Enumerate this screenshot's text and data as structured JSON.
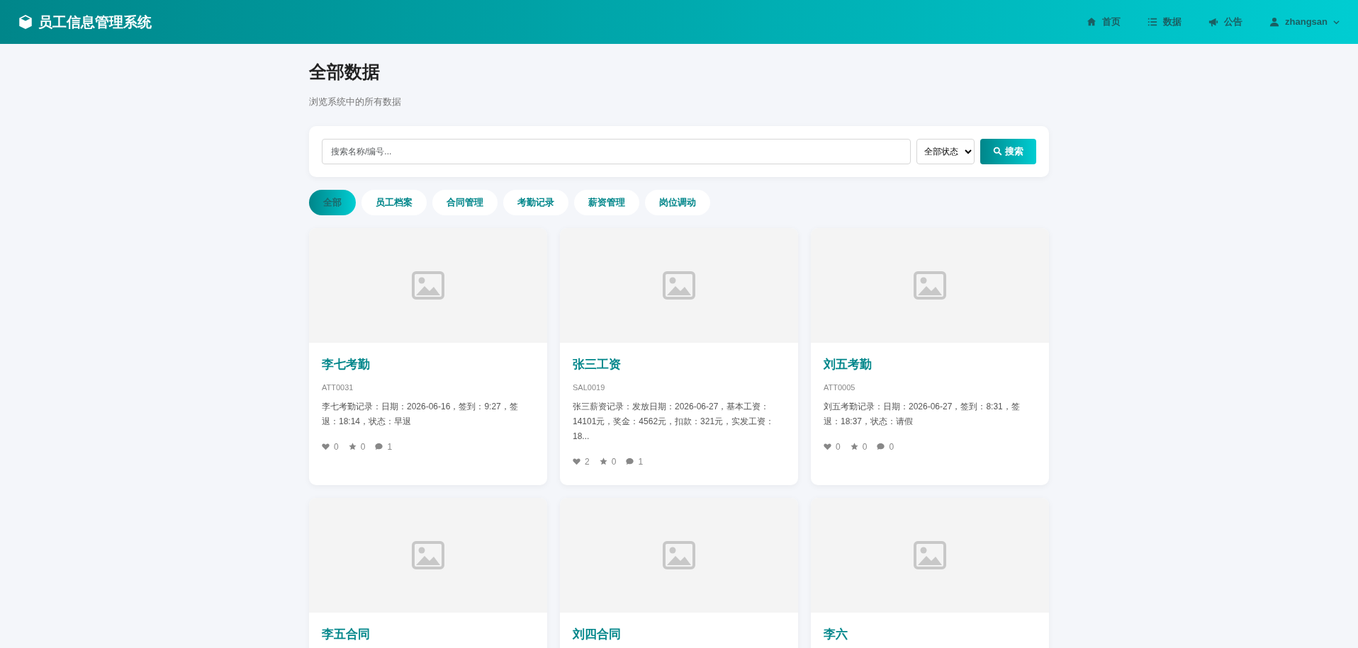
{
  "brand": {
    "title": "员工信息管理系统"
  },
  "nav": [
    {
      "kind": "home",
      "label": "首页"
    },
    {
      "kind": "list",
      "label": "数据"
    },
    {
      "kind": "notice",
      "label": "公告"
    },
    {
      "kind": "user",
      "label": "zhangsan"
    }
  ],
  "page": {
    "title": "全部数据",
    "subtitle": "浏览系统中的所有数据"
  },
  "search": {
    "placeholder": "搜索名称/编号...",
    "status_select": "全部状态",
    "button": "搜索"
  },
  "tabs": [
    {
      "label": "全部",
      "selected": true
    },
    {
      "label": "员工档案",
      "selected": false
    },
    {
      "label": "合同管理",
      "selected": false
    },
    {
      "label": "考勤记录",
      "selected": false
    },
    {
      "label": "薪资管理",
      "selected": false
    },
    {
      "label": "岗位调动",
      "selected": false
    }
  ],
  "cards": [
    {
      "title": "李七考勤",
      "code": "ATT0031",
      "description": "李七考勤记录：日期：2026-06-16，签到：9:27，签退：18:14，状态：早退",
      "likes": "0",
      "favorites": "0",
      "comments": "1"
    },
    {
      "title": "张三工资",
      "code": "SAL0019",
      "description": "张三薪资记录：发放日期：2026-06-27，基本工资：14101元，奖金：4562元，扣款：321元，实发工资：18...",
      "likes": "2",
      "favorites": "0",
      "comments": "1"
    },
    {
      "title": "刘五考勤",
      "code": "ATT0005",
      "description": "刘五考勤记录：日期：2026-06-27，签到：8:31，签退：18:37，状态：请假",
      "likes": "0",
      "favorites": "0",
      "comments": "0"
    },
    {
      "title": "李五合同"
    },
    {
      "title": "刘四合同"
    },
    {
      "title": "李六"
    }
  ]
}
